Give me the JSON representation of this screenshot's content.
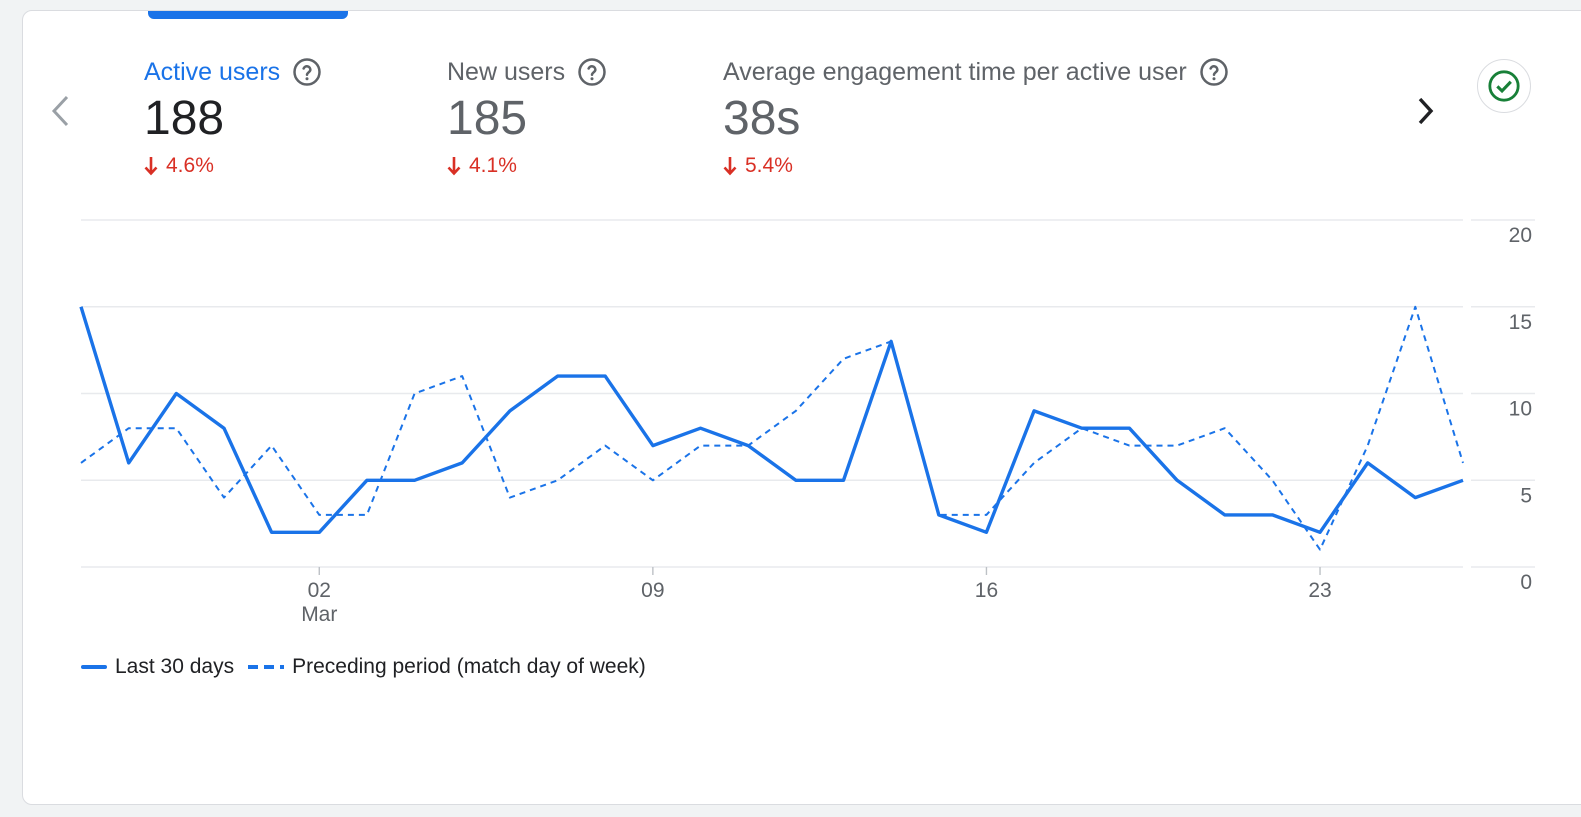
{
  "colors": {
    "accent": "#1a73e8",
    "negative": "#d93025",
    "success": "#188038",
    "text_primary": "#202124",
    "text_secondary": "#5f6368",
    "grid": "#e8eaed"
  },
  "icons": {
    "prev": "chevron-left-icon",
    "next": "chevron-right-icon",
    "help": "help-circle-icon",
    "check": "check-circle-icon",
    "down": "arrow-down-icon"
  },
  "metrics": [
    {
      "title": "Active users",
      "value": "188",
      "change": "4.6%",
      "active": true
    },
    {
      "title": "New users",
      "value": "185",
      "change": "4.1%",
      "active": false
    },
    {
      "title": "Average engagement time per active user",
      "value": "38s",
      "change": "5.4%",
      "active": false
    }
  ],
  "legend": {
    "current": "Last 30 days",
    "previous": "Preceding period (match day of week)"
  },
  "chart_data": {
    "type": "line",
    "x_tick_labels": [
      {
        "day_index": 5,
        "label": "02",
        "sublabel": "Mar"
      },
      {
        "day_index": 12,
        "label": "09",
        "sublabel": ""
      },
      {
        "day_index": 19,
        "label": "16",
        "sublabel": ""
      },
      {
        "day_index": 26,
        "label": "23",
        "sublabel": ""
      }
    ],
    "y_ticks": [
      0,
      5,
      10,
      15,
      20
    ],
    "ylim": [
      0,
      20
    ],
    "grid": true,
    "y_axis_position": "right",
    "legend_position": "bottom-left",
    "series": [
      {
        "name": "Last 30 days",
        "style": "solid",
        "values": [
          15,
          6,
          10,
          8,
          2,
          2,
          5,
          5,
          6,
          9,
          11,
          11,
          7,
          8,
          7,
          5,
          5,
          13,
          3,
          2,
          9,
          8,
          8,
          5,
          3,
          3,
          2,
          6,
          4,
          5
        ]
      },
      {
        "name": "Preceding period (match day of week)",
        "style": "dashed",
        "values": [
          6,
          8,
          8,
          4,
          7,
          3,
          3,
          10,
          11,
          4,
          5,
          7,
          5,
          7,
          7,
          9,
          12,
          13,
          3,
          3,
          6,
          8,
          7,
          7,
          8,
          5,
          1,
          7,
          15,
          6
        ]
      }
    ]
  }
}
